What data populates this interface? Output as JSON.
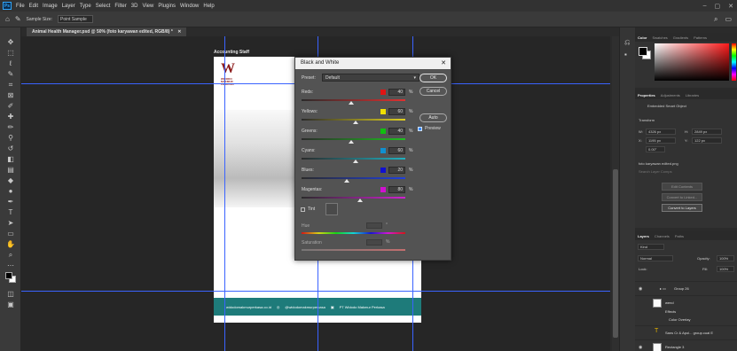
{
  "app": {
    "logo": "Ps",
    "menu": [
      "File",
      "Edit",
      "Image",
      "Layer",
      "Type",
      "Select",
      "Filter",
      "3D",
      "View",
      "Plugins",
      "Window",
      "Help"
    ],
    "window_controls": [
      "–",
      "▢",
      "✕"
    ]
  },
  "options_bar": {
    "sample_size_label": "Sample Size:",
    "sample_size_value": "Point Sample"
  },
  "document": {
    "tab_title": "Animal Health Manager.psd @ 50% (foto karyawan edited, RGB/8) *",
    "tab_close": "✕",
    "artboard_label": "Accounting Staff",
    "logo_letter": "W",
    "logo_text": "WIDODO MAKMUR PERKASA",
    "footer": {
      "website": "widodomakmurperkasa.co.id",
      "instagram": "@widodomakmurperkasa",
      "linkedin": "PT Widodo Makmur Perkasa"
    }
  },
  "dialog": {
    "title": "Black and White",
    "close": "✕",
    "preset_label": "Preset:",
    "preset_value": "Default",
    "buttons": {
      "ok": "OK",
      "cancel": "Cancel",
      "auto": "Auto"
    },
    "preview_label": "Preview",
    "sliders": [
      {
        "label": "Reds:",
        "value": "40",
        "pct": 40,
        "unit": "%",
        "chip": "#e01414",
        "track": "linear-gradient(90deg,#2a2a2a,#e03030)"
      },
      {
        "label": "Yellows:",
        "value": "60",
        "pct": 60,
        "unit": "%",
        "chip": "#f0e000",
        "track": "linear-gradient(90deg,#2a2a2a,#e0d020)"
      },
      {
        "label": "Greens:",
        "value": "40",
        "pct": 40,
        "unit": "%",
        "chip": "#10c010",
        "track": "linear-gradient(90deg,#2a2a2a,#20c020)"
      },
      {
        "label": "Cyans:",
        "value": "60",
        "pct": 60,
        "unit": "%",
        "chip": "#1090d0",
        "track": "linear-gradient(90deg,#2a2a2a,#20b0c0)"
      },
      {
        "label": "Blues:",
        "value": "20",
        "pct": 20,
        "unit": "%",
        "chip": "#1010d0",
        "track": "linear-gradient(90deg,#2a2a2a,#2040e0)"
      },
      {
        "label": "Magentas:",
        "value": "80",
        "pct": 80,
        "unit": "%",
        "chip": "#d010d0",
        "track": "linear-gradient(90deg,#2a2a2a,#d020d0)"
      }
    ],
    "tint_label": "Tint",
    "hue_label": "Hue",
    "hue_unit": "°",
    "saturation_label": "Saturation",
    "saturation_unit": "%"
  },
  "panels": {
    "color_tabs": [
      "Color",
      "Swatches",
      "Gradients",
      "Patterns"
    ],
    "properties_tabs": [
      "Properties",
      "Adjustments",
      "Libraries"
    ],
    "smart_object_label": "Embedded Smart Object",
    "transform_label": "Transform",
    "w_label": "W:",
    "w_value": "4326 px",
    "h_label": "H:",
    "h_value": "2849 px",
    "x_label": "X:",
    "x_value": "1195 px",
    "y_label": "Y:",
    "y_value": "122 px",
    "angle_value": "0.00°",
    "file_label": "foto karyawan edited.png",
    "search_layer_label": "Search Layer Comps",
    "edit_contents": "Edit Contents",
    "convert_to_linked": "Convert to Linked...",
    "convert_to_layers": "Convert to Layers",
    "layers_tabs": [
      "Layers",
      "Channels",
      "Paths"
    ],
    "kind_label": "Kind",
    "blend_mode": "Normal",
    "opacity_label": "Opacity:",
    "opacity_value": "100%",
    "lock_label": "Lock:",
    "fill_label": "Fill:",
    "fill_value": "100%",
    "layers": [
      {
        "name": "Group 26"
      },
      {
        "name": "wend"
      },
      {
        "name": "Effects"
      },
      {
        "name": "Color Overlay"
      },
      {
        "name": "Sans Cr & Apol... group.cual E"
      },
      {
        "name": "Rectangle 3"
      }
    ]
  }
}
